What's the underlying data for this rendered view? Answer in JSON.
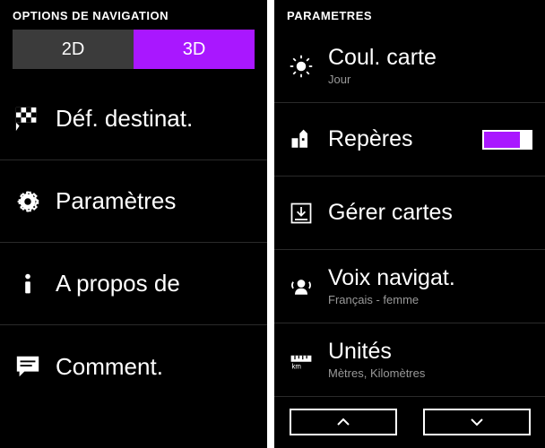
{
  "left": {
    "header": "OPTIONS DE NAVIGATION",
    "toggle": {
      "off": "2D",
      "on": "3D"
    },
    "items": [
      {
        "label": "Déf. destinat."
      },
      {
        "label": "Paramètres"
      },
      {
        "label": "A propos de"
      },
      {
        "label": "Comment."
      }
    ]
  },
  "right": {
    "header": "PARAMETRES",
    "items": [
      {
        "label": "Coul. carte",
        "sub": "Jour"
      },
      {
        "label": "Repères"
      },
      {
        "label": "Gérer cartes"
      },
      {
        "label": "Voix navigat.",
        "sub": "Français - femme"
      },
      {
        "label": "Unités",
        "sub": "Mètres, Kilomètres"
      }
    ]
  }
}
